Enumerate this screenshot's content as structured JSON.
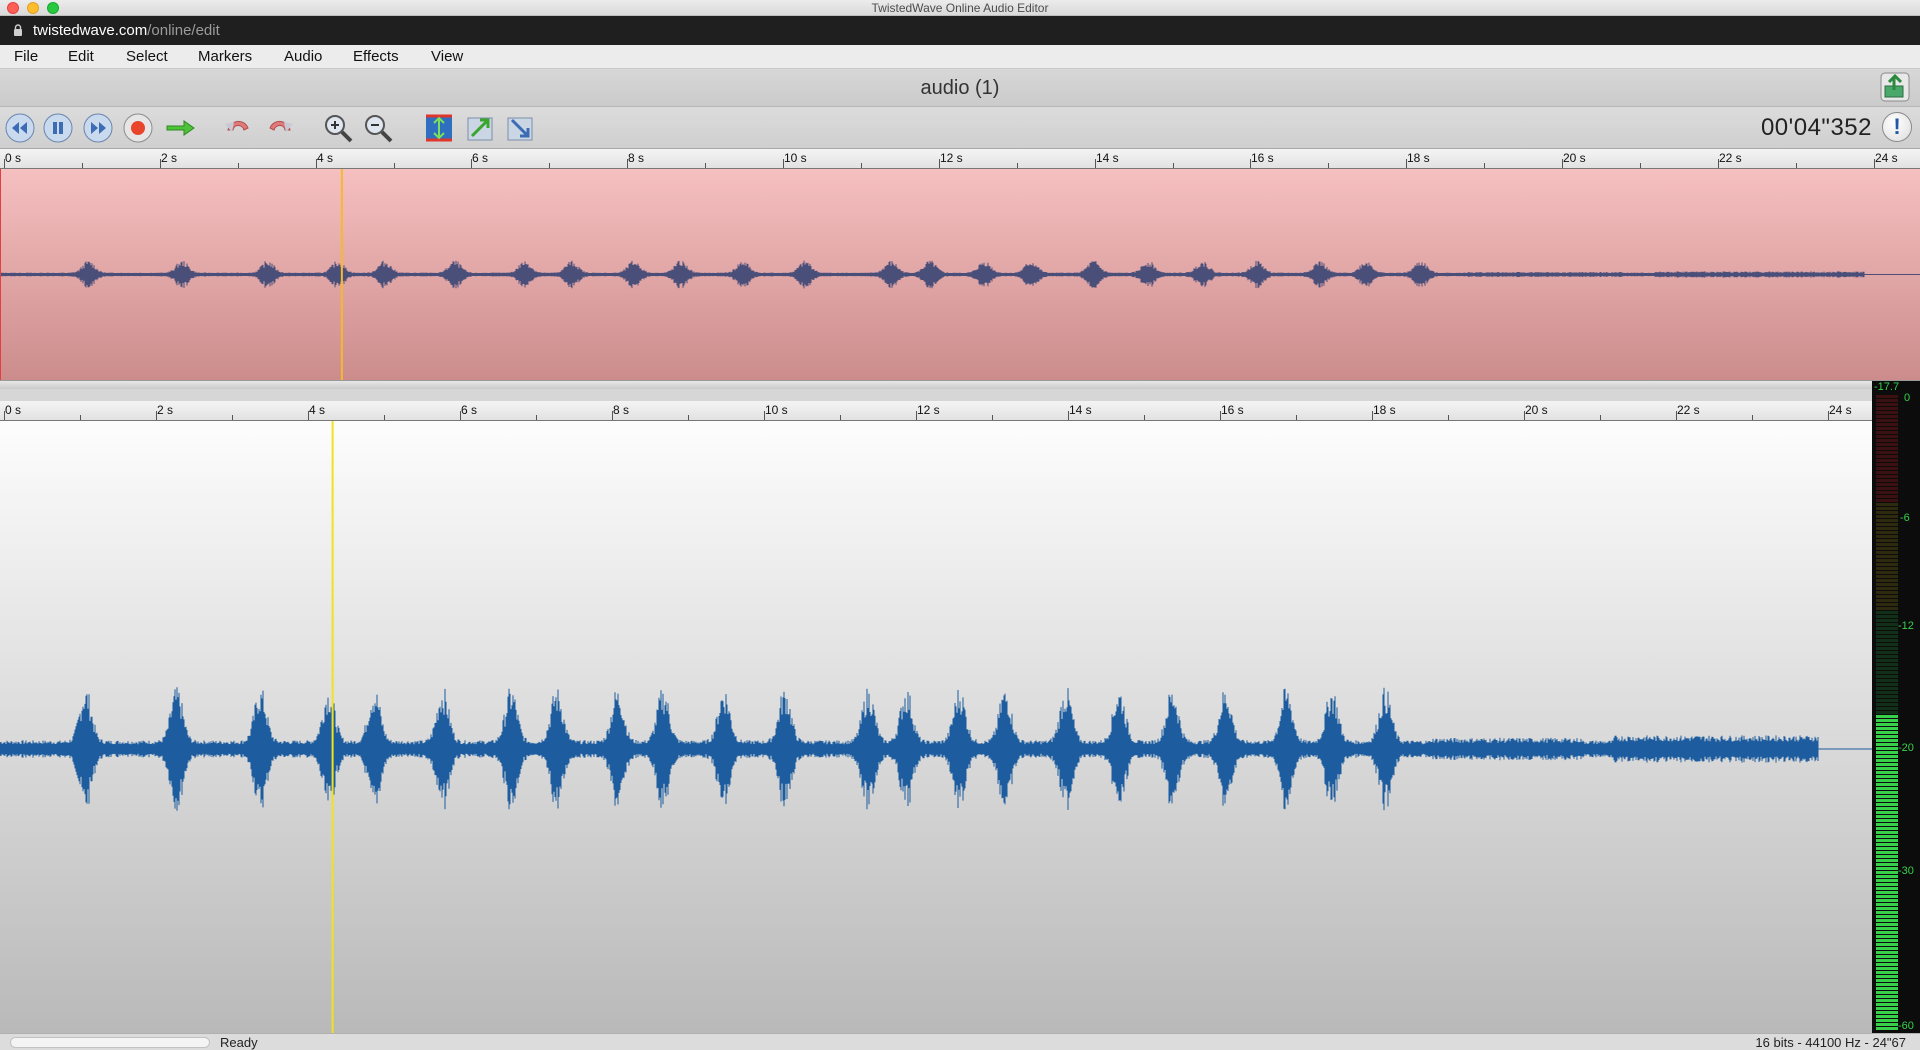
{
  "window": {
    "title": "TwistedWave Online Audio Editor"
  },
  "browser": {
    "url_host": "twistedwave.com",
    "url_path": "/online/edit"
  },
  "menu": [
    "File",
    "Edit",
    "Select",
    "Markers",
    "Audio",
    "Effects",
    "View"
  ],
  "document": {
    "title": "audio (1)"
  },
  "toolbar": {
    "timecode": "00'04\"352",
    "info_glyph": "!",
    "buttons": [
      "rewind-icon",
      "pause-icon",
      "fast-forward-icon",
      "record-icon",
      "play-selection-icon",
      "undo-icon",
      "redo-icon",
      "zoom-in-icon",
      "zoom-out-icon",
      "fit-vertical-icon",
      "zoom-selection-icon",
      "zoom-all-icon"
    ]
  },
  "overview": {
    "ruler_labels": [
      "0 s",
      "2 s",
      "4 s",
      "6 s",
      "8 s",
      "10 s",
      "12 s",
      "14 s",
      "16 s",
      "18 s",
      "20 s",
      "22 s",
      "24 s"
    ],
    "cursor_time_s": 4.35,
    "visible_duration_s": 24.67,
    "waveform_color": "#4a4f7a",
    "cursor_color": "#f5b82e"
  },
  "main": {
    "ruler_labels": [
      "0 s",
      "2 s",
      "4 s",
      "6 s",
      "8 s",
      "10 s",
      "12 s",
      "14 s",
      "16 s",
      "18 s",
      "20 s",
      "22 s",
      "24 s"
    ],
    "cursor_time_s": 4.35,
    "visible_duration_s": 24.67,
    "waveform_color": "#1c5c9f",
    "cursor_color": "#f2e11d"
  },
  "meter": {
    "labels": [
      "-17.7",
      "0",
      "-6",
      "-12",
      "-20",
      "-30",
      "-60"
    ],
    "level_db": -20,
    "color": "#38d04a"
  },
  "status": {
    "text": "Ready",
    "format": "16 bits - 44100 Hz - 24\"67"
  }
}
